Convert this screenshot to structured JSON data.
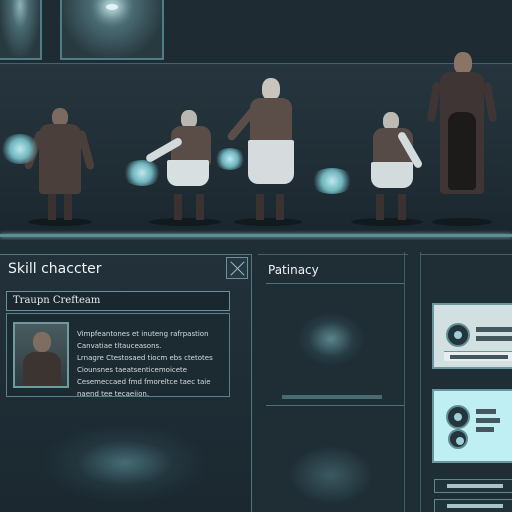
{
  "skill_panel": {
    "title": "Skill chaccter",
    "subtitle": "Traupn Crefteam",
    "description_lines": [
      "Vimpfeantones et inuteng rafrpastion",
      "Canvatiae tltauceasons.",
      "Lrnagre Ctestosaed tiocm ebs ctetotes",
      "Ciounsnes taeatsenticemoicete",
      "Cesemeccaed fmd fmoreltce taec taie",
      "naend tee tecaeiion."
    ]
  },
  "middle_panel": {
    "title": "Patinacy"
  },
  "characters": [
    {
      "id": "hero-1",
      "pose": "standing",
      "coat": "#4b3f3c"
    },
    {
      "id": "hero-2",
      "pose": "casting",
      "coat": "#d8dfe0"
    },
    {
      "id": "hero-3",
      "pose": "standing",
      "coat": "#d6dcdd"
    },
    {
      "id": "hero-4",
      "pose": "casting",
      "coat": "#d3dbdd"
    },
    {
      "id": "hero-5",
      "pose": "standing",
      "coat": "#3e3534"
    }
  ],
  "colors": {
    "background": "#22303a",
    "accent": "#5e8d94",
    "glow": "#bfe9ee"
  },
  "icons": [
    "close-icon",
    "skill-icon"
  ]
}
